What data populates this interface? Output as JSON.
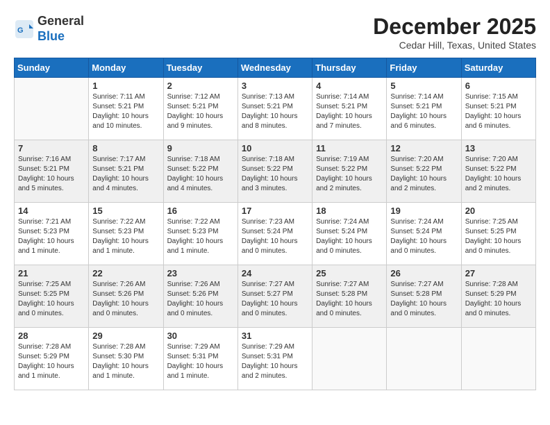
{
  "header": {
    "logo_line1": "General",
    "logo_line2": "Blue",
    "month_title": "December 2025",
    "location": "Cedar Hill, Texas, United States"
  },
  "weekdays": [
    "Sunday",
    "Monday",
    "Tuesday",
    "Wednesday",
    "Thursday",
    "Friday",
    "Saturday"
  ],
  "weeks": [
    [
      {
        "day": "",
        "info": ""
      },
      {
        "day": "1",
        "info": "Sunrise: 7:11 AM\nSunset: 5:21 PM\nDaylight: 10 hours\nand 10 minutes."
      },
      {
        "day": "2",
        "info": "Sunrise: 7:12 AM\nSunset: 5:21 PM\nDaylight: 10 hours\nand 9 minutes."
      },
      {
        "day": "3",
        "info": "Sunrise: 7:13 AM\nSunset: 5:21 PM\nDaylight: 10 hours\nand 8 minutes."
      },
      {
        "day": "4",
        "info": "Sunrise: 7:14 AM\nSunset: 5:21 PM\nDaylight: 10 hours\nand 7 minutes."
      },
      {
        "day": "5",
        "info": "Sunrise: 7:14 AM\nSunset: 5:21 PM\nDaylight: 10 hours\nand 6 minutes."
      },
      {
        "day": "6",
        "info": "Sunrise: 7:15 AM\nSunset: 5:21 PM\nDaylight: 10 hours\nand 6 minutes."
      }
    ],
    [
      {
        "day": "7",
        "info": "Sunrise: 7:16 AM\nSunset: 5:21 PM\nDaylight: 10 hours\nand 5 minutes."
      },
      {
        "day": "8",
        "info": "Sunrise: 7:17 AM\nSunset: 5:21 PM\nDaylight: 10 hours\nand 4 minutes."
      },
      {
        "day": "9",
        "info": "Sunrise: 7:18 AM\nSunset: 5:22 PM\nDaylight: 10 hours\nand 4 minutes."
      },
      {
        "day": "10",
        "info": "Sunrise: 7:18 AM\nSunset: 5:22 PM\nDaylight: 10 hours\nand 3 minutes."
      },
      {
        "day": "11",
        "info": "Sunrise: 7:19 AM\nSunset: 5:22 PM\nDaylight: 10 hours\nand 2 minutes."
      },
      {
        "day": "12",
        "info": "Sunrise: 7:20 AM\nSunset: 5:22 PM\nDaylight: 10 hours\nand 2 minutes."
      },
      {
        "day": "13",
        "info": "Sunrise: 7:20 AM\nSunset: 5:22 PM\nDaylight: 10 hours\nand 2 minutes."
      }
    ],
    [
      {
        "day": "14",
        "info": "Sunrise: 7:21 AM\nSunset: 5:23 PM\nDaylight: 10 hours\nand 1 minute."
      },
      {
        "day": "15",
        "info": "Sunrise: 7:22 AM\nSunset: 5:23 PM\nDaylight: 10 hours\nand 1 minute."
      },
      {
        "day": "16",
        "info": "Sunrise: 7:22 AM\nSunset: 5:23 PM\nDaylight: 10 hours\nand 1 minute."
      },
      {
        "day": "17",
        "info": "Sunrise: 7:23 AM\nSunset: 5:24 PM\nDaylight: 10 hours\nand 0 minutes."
      },
      {
        "day": "18",
        "info": "Sunrise: 7:24 AM\nSunset: 5:24 PM\nDaylight: 10 hours\nand 0 minutes."
      },
      {
        "day": "19",
        "info": "Sunrise: 7:24 AM\nSunset: 5:24 PM\nDaylight: 10 hours\nand 0 minutes."
      },
      {
        "day": "20",
        "info": "Sunrise: 7:25 AM\nSunset: 5:25 PM\nDaylight: 10 hours\nand 0 minutes."
      }
    ],
    [
      {
        "day": "21",
        "info": "Sunrise: 7:25 AM\nSunset: 5:25 PM\nDaylight: 10 hours\nand 0 minutes."
      },
      {
        "day": "22",
        "info": "Sunrise: 7:26 AM\nSunset: 5:26 PM\nDaylight: 10 hours\nand 0 minutes."
      },
      {
        "day": "23",
        "info": "Sunrise: 7:26 AM\nSunset: 5:26 PM\nDaylight: 10 hours\nand 0 minutes."
      },
      {
        "day": "24",
        "info": "Sunrise: 7:27 AM\nSunset: 5:27 PM\nDaylight: 10 hours\nand 0 minutes."
      },
      {
        "day": "25",
        "info": "Sunrise: 7:27 AM\nSunset: 5:28 PM\nDaylight: 10 hours\nand 0 minutes."
      },
      {
        "day": "26",
        "info": "Sunrise: 7:27 AM\nSunset: 5:28 PM\nDaylight: 10 hours\nand 0 minutes."
      },
      {
        "day": "27",
        "info": "Sunrise: 7:28 AM\nSunset: 5:29 PM\nDaylight: 10 hours\nand 0 minutes."
      }
    ],
    [
      {
        "day": "28",
        "info": "Sunrise: 7:28 AM\nSunset: 5:29 PM\nDaylight: 10 hours\nand 1 minute."
      },
      {
        "day": "29",
        "info": "Sunrise: 7:28 AM\nSunset: 5:30 PM\nDaylight: 10 hours\nand 1 minute."
      },
      {
        "day": "30",
        "info": "Sunrise: 7:29 AM\nSunset: 5:31 PM\nDaylight: 10 hours\nand 1 minute."
      },
      {
        "day": "31",
        "info": "Sunrise: 7:29 AM\nSunset: 5:31 PM\nDaylight: 10 hours\nand 2 minutes."
      },
      {
        "day": "",
        "info": ""
      },
      {
        "day": "",
        "info": ""
      },
      {
        "day": "",
        "info": ""
      }
    ]
  ]
}
